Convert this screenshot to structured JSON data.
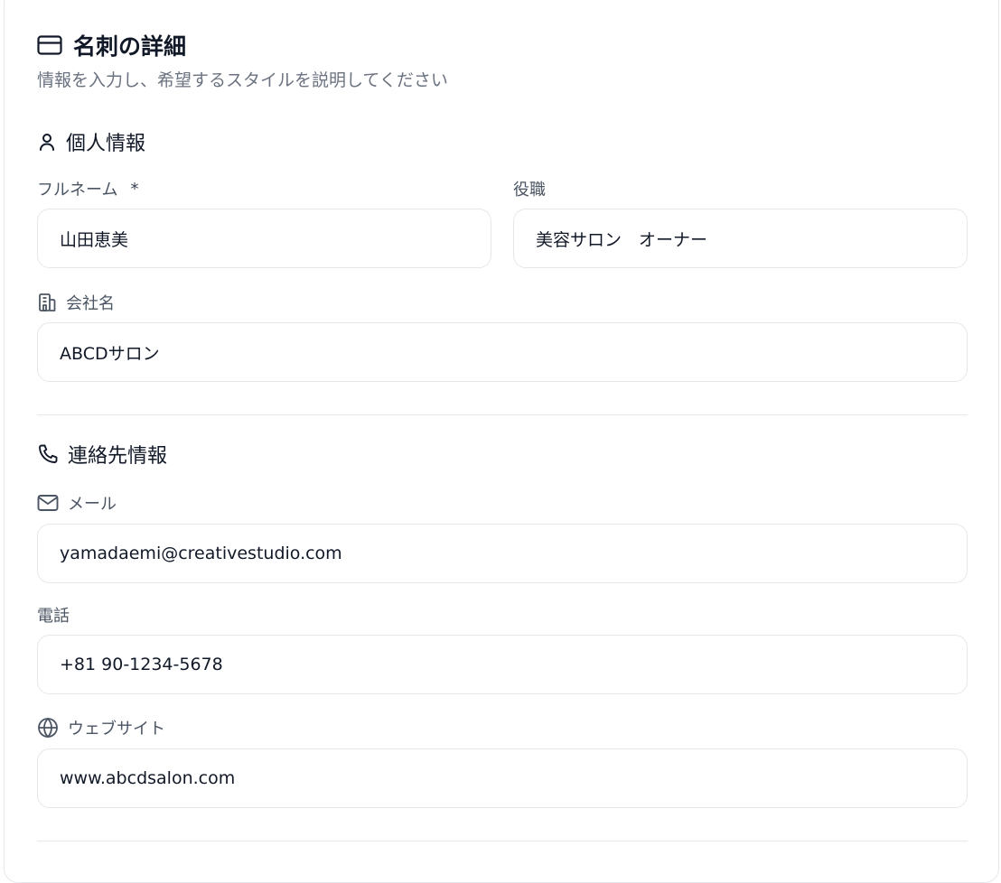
{
  "header": {
    "icon": "credit-card-icon",
    "title": "名刺の詳細",
    "description": "情報を入力し、希望するスタイルを説明してください"
  },
  "personal": {
    "icon": "user-icon",
    "title": "個人情報",
    "full_name": {
      "label": "フルネーム",
      "required_mark": "*",
      "value": "山田恵美"
    },
    "job_title": {
      "label": "役職",
      "value": "美容サロン　オーナー"
    },
    "company": {
      "icon": "building-icon",
      "label": "会社名",
      "value": "ABCDサロン"
    }
  },
  "contact": {
    "icon": "phone-icon",
    "title": "連絡先情報",
    "email": {
      "icon": "mail-icon",
      "label": "メール",
      "value": "yamadaemi@creativestudio.com"
    },
    "phone": {
      "label": "電話",
      "value": "+81 90-1234-5678"
    },
    "website": {
      "icon": "globe-icon",
      "label": "ウェブサイト",
      "value": "www.abcdsalon.com"
    }
  }
}
